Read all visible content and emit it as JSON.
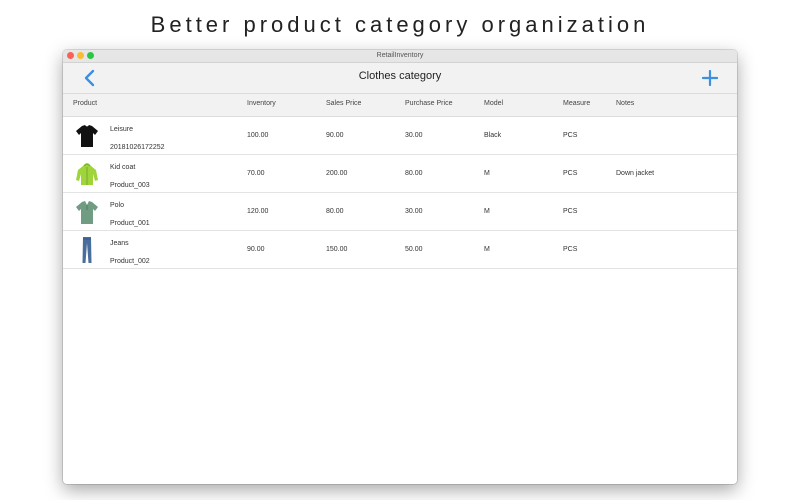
{
  "banner": {
    "title": "Better product category organization"
  },
  "window": {
    "title": "RetailInventory"
  },
  "navbar": {
    "title": "Clothes category",
    "back_icon": "chevron-left-icon",
    "add_icon": "plus-icon",
    "accent_color": "#3d8fe0"
  },
  "table": {
    "headers": {
      "product": "Product",
      "inventory": "Inventory",
      "sales_price": "Sales Price",
      "purchase_price": "Purchase Price",
      "model": "Model",
      "measure": "Measure",
      "notes": "Notes"
    },
    "rows": [
      {
        "icon": "tshirt-icon",
        "name": "Leisure",
        "code": "20181026172252",
        "inventory": "100.00",
        "sales_price": "90.00",
        "purchase_price": "30.00",
        "model": "Black",
        "measure": "PCS",
        "notes": ""
      },
      {
        "icon": "hooded-coat-icon",
        "name": "Kid coat",
        "code": "Product_003",
        "inventory": "70.00",
        "sales_price": "200.00",
        "purchase_price": "80.00",
        "model": "M",
        "measure": "PCS",
        "notes": "Down jacket"
      },
      {
        "icon": "polo-shirt-icon",
        "name": "Polo",
        "code": "Product_001",
        "inventory": "120.00",
        "sales_price": "80.00",
        "purchase_price": "30.00",
        "model": "M",
        "measure": "PCS",
        "notes": ""
      },
      {
        "icon": "jeans-icon",
        "name": "Jeans",
        "code": "Product_002",
        "inventory": "90.00",
        "sales_price": "150.00",
        "purchase_price": "50.00",
        "model": "M",
        "measure": "PCS",
        "notes": ""
      }
    ]
  }
}
